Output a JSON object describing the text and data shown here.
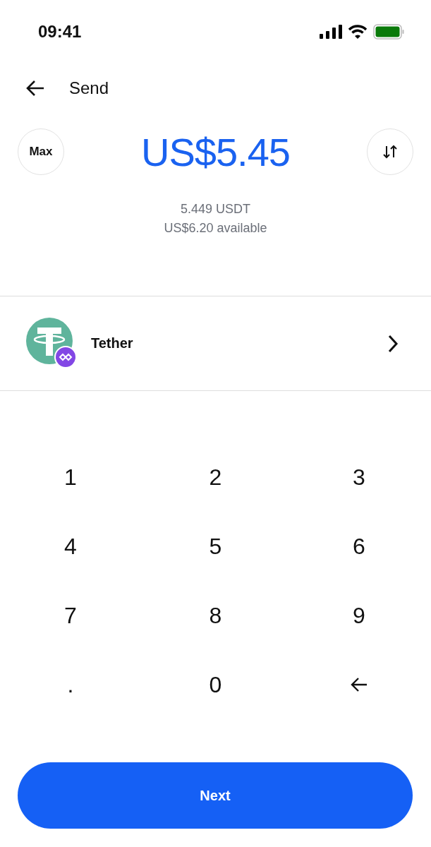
{
  "status_bar": {
    "time": "09:41"
  },
  "header": {
    "title": "Send"
  },
  "amount": {
    "max_label": "Max",
    "value": "US$5.45",
    "crypto_value": "5.449 USDT",
    "available": "US$6.20 available"
  },
  "asset": {
    "name": "Tether"
  },
  "keypad": [
    {
      "kind": "digit",
      "label": "1"
    },
    {
      "kind": "digit",
      "label": "2"
    },
    {
      "kind": "digit",
      "label": "3"
    },
    {
      "kind": "digit",
      "label": "4"
    },
    {
      "kind": "digit",
      "label": "5"
    },
    {
      "kind": "digit",
      "label": "6"
    },
    {
      "kind": "digit",
      "label": "7"
    },
    {
      "kind": "digit",
      "label": "8"
    },
    {
      "kind": "digit",
      "label": "9"
    },
    {
      "kind": "digit",
      "label": "."
    },
    {
      "kind": "digit",
      "label": "0"
    },
    {
      "kind": "backspace"
    }
  ],
  "next_button": {
    "label": "Next"
  }
}
